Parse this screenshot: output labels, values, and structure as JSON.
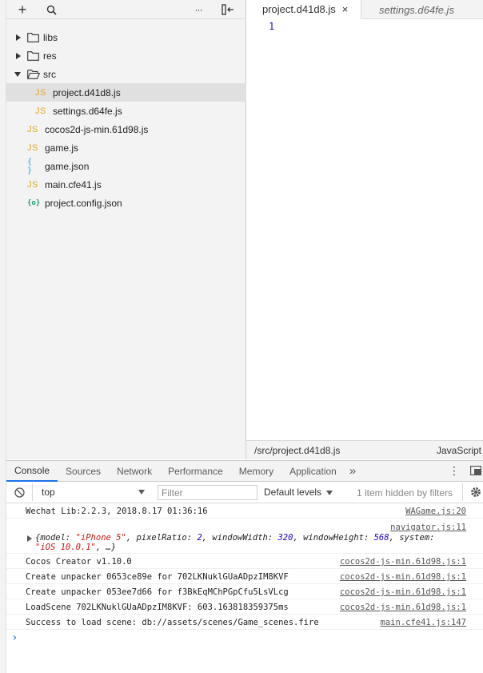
{
  "navigator": {
    "toolbar": {
      "new": "+",
      "search": "⌕",
      "more": "···"
    },
    "tree": [
      {
        "label": "libs",
        "type": "folder",
        "expanded": false
      },
      {
        "label": "res",
        "type": "folder",
        "expanded": false
      },
      {
        "label": "src",
        "type": "folder",
        "expanded": true
      },
      {
        "label": "project.d41d8.js",
        "type": "js",
        "icon_text": "JS"
      },
      {
        "label": "settings.d64fe.js",
        "type": "js",
        "icon_text": "JS"
      },
      {
        "label": "cocos2d-js-min.61d98.js",
        "type": "js",
        "icon_text": "JS"
      },
      {
        "label": "game.js",
        "type": "js",
        "icon_text": "JS"
      },
      {
        "label": "game.json",
        "type": "json",
        "icon_text": "{ }"
      },
      {
        "label": "main.cfe41.js",
        "type": "js",
        "icon_text": "JS"
      },
      {
        "label": "project.config.json",
        "type": "config",
        "icon_text": "{o}"
      }
    ]
  },
  "editor": {
    "tabs": [
      {
        "label": "project.d41d8.js",
        "close": "×"
      },
      {
        "label": "settings.d64fe.js"
      }
    ],
    "line_number": "1",
    "status_path": "/src/project.d41d8.js",
    "status_lang": "JavaScript"
  },
  "drawer": {
    "tabs": [
      "Console",
      "Sources",
      "Network",
      "Performance",
      "Memory",
      "Application"
    ],
    "overflow": "»",
    "menu": "⋮"
  },
  "console": {
    "context": "top",
    "filter_placeholder": "Filter",
    "levels": "Default levels",
    "hidden": "1 item hidden by filters",
    "messages": [
      {
        "text": "Wechat Lib:2.2.3, 2018.8.17 01:36:16",
        "source": "WAGame.js:20"
      },
      {
        "object_source": "navigator.js:11",
        "parts": [
          {
            "t": "{",
            "c": "k"
          },
          {
            "t": "model: ",
            "c": "k"
          },
          {
            "t": "\"iPhone 5\"",
            "c": "str"
          },
          {
            "t": ", pixelRatio: ",
            "c": "k"
          },
          {
            "t": "2",
            "c": "num"
          },
          {
            "t": ", windowWidth: ",
            "c": "k"
          },
          {
            "t": "320",
            "c": "num"
          },
          {
            "t": ", windowHeight: ",
            "c": "k"
          },
          {
            "t": "568",
            "c": "num"
          },
          {
            "t": ", system: ",
            "c": "k"
          }
        ],
        "parts2": [
          {
            "t": "\"iOS 10.0.1\"",
            "c": "str"
          },
          {
            "t": ", …}",
            "c": "k"
          }
        ]
      },
      {
        "text": "Cocos Creator v1.10.0",
        "source": "cocos2d-js-min.61d98.js:1"
      },
      {
        "text": "Create unpacker 0653ce89e for 702LKNuklGUaADpzIM8KVF",
        "source": "cocos2d-js-min.61d98.js:1"
      },
      {
        "text": "Create unpacker 053ee7d66 for f3BkEqMChPGpCfu5LsVLcg",
        "source": "cocos2d-js-min.61d98.js:1"
      },
      {
        "text": "LoadScene 702LKNuklGUaADpzIM8KVF: 603.163818359375ms",
        "source": "cocos2d-js-min.61d98.js:1"
      },
      {
        "text": "Success to load scene: db://assets/scenes/Game_scenes.fire",
        "source": "main.cfe41.js:147"
      }
    ],
    "prompt": "›"
  }
}
